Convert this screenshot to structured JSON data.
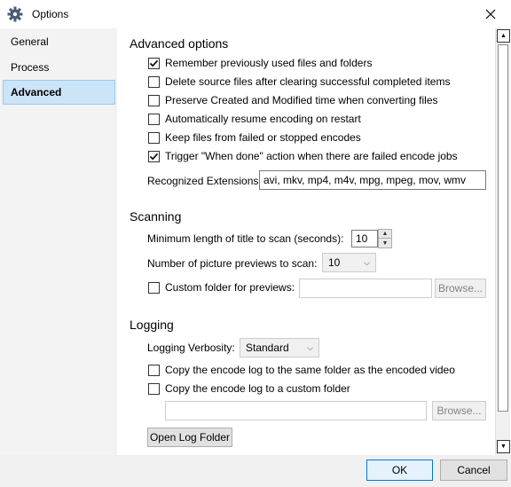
{
  "window": {
    "title": "Options",
    "icon": "gear-icon"
  },
  "sidebar": {
    "items": [
      {
        "label": "General",
        "active": false
      },
      {
        "label": "Process",
        "active": false
      },
      {
        "label": "Advanced",
        "active": true
      }
    ]
  },
  "advanced": {
    "heading": "Advanced options",
    "checkboxes": [
      {
        "label": "Remember previously used files and folders",
        "checked": true
      },
      {
        "label": "Delete source files after clearing successful completed items",
        "checked": false
      },
      {
        "label": "Preserve Created and Modified time when converting files",
        "checked": false
      },
      {
        "label": "Automatically resume encoding on restart",
        "checked": false
      },
      {
        "label": "Keep files from failed or stopped encodes",
        "checked": false
      },
      {
        "label": "Trigger \"When done\" action when there are failed encode jobs",
        "checked": true
      }
    ],
    "extensions_label": "Recognized Extensions:",
    "extensions_value": "avi, mkv, mp4, m4v, mpg, mpeg, mov, wmv"
  },
  "scanning": {
    "heading": "Scanning",
    "min_length_label": "Minimum length of title to scan (seconds):",
    "min_length_value": "10",
    "previews_label": "Number of picture previews to scan:",
    "previews_value": "10",
    "custom_folder_label": "Custom folder for previews:",
    "custom_folder_checked": false,
    "custom_folder_value": "",
    "browse_label": "Browse..."
  },
  "logging": {
    "heading": "Logging",
    "verbosity_label": "Logging Verbosity:",
    "verbosity_value": "Standard",
    "copy_same_label": "Copy the encode log to the same folder as the encoded video",
    "copy_same_checked": false,
    "copy_custom_label": "Copy the encode log to a custom folder",
    "copy_custom_checked": false,
    "custom_path_value": "",
    "browse_label": "Browse...",
    "open_log_label": "Open Log Folder"
  },
  "footer": {
    "ok_label": "OK",
    "cancel_label": "Cancel"
  }
}
